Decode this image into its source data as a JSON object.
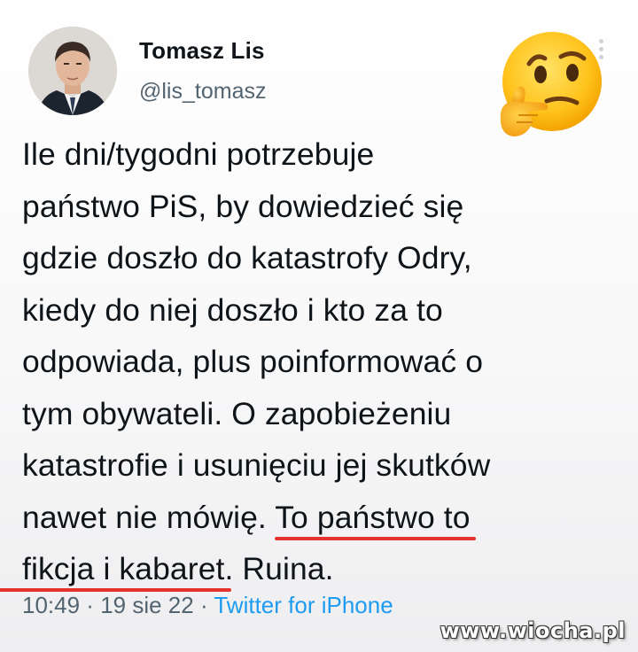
{
  "user": {
    "name": "Tomasz Lis",
    "handle": "@lis_tomasz",
    "avatar_icon": "profile-photo"
  },
  "reaction_icon": "thinking-face-emoji",
  "tweet": {
    "lines": [
      "Ile dni/tygodni potrzebuje",
      "państwo PiS, by dowiedzieć  się",
      "gdzie doszło do katastrofy Odry,",
      "kiedy do niej doszło i kto za to",
      "odpowiada, plus poinformować o",
      "tym obywateli. O zapobieżeniu",
      "katastrofie i usunięciu jej skutków"
    ],
    "line8_plain": "nawet nie mówię. ",
    "line8_highlight": "To państwo to",
    "line9_highlight": "fikcja i kabaret.",
    "line9_plain": " Ruina.",
    "highlight_color": "#e6322e"
  },
  "meta": {
    "time": "10:49",
    "separator1": " · ",
    "date": "19 sie 22",
    "separator2": " · ",
    "source": "Twitter for iPhone"
  },
  "watermark": "www.wiocha.pl",
  "colors": {
    "text": "#0f1419",
    "secondary": "#536471",
    "link": "#1d9bf0"
  }
}
